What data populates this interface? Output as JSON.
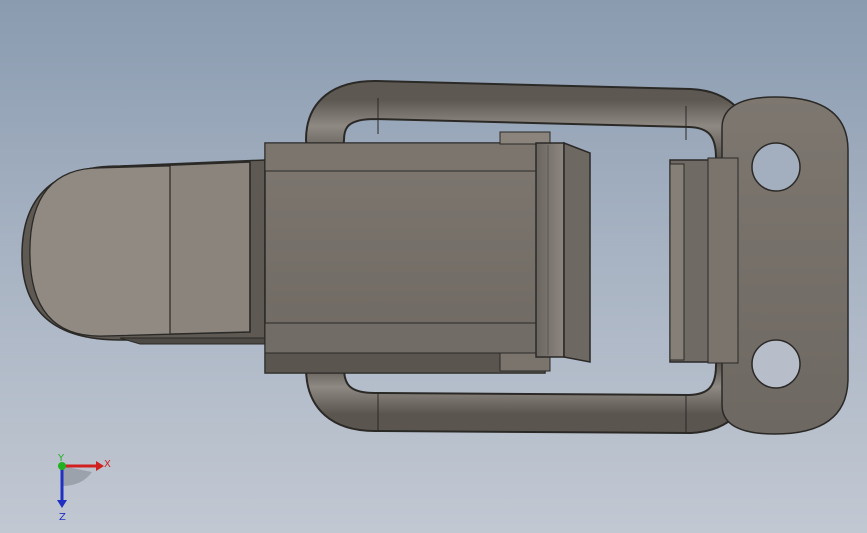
{
  "viewport": {
    "background_top": "#8a9bb0",
    "background_bottom": "#c2c8d2"
  },
  "model": {
    "subject": "toggle-latch-clamp",
    "body_color": "#777069",
    "edge_color": "#2b2926",
    "highlight_color": "#9a948d"
  },
  "triad": {
    "x_label": "X",
    "y_label": "Y",
    "z_label": "Z",
    "x_color": "#d02020",
    "y_color": "#20b020",
    "z_color": "#2030c0"
  }
}
